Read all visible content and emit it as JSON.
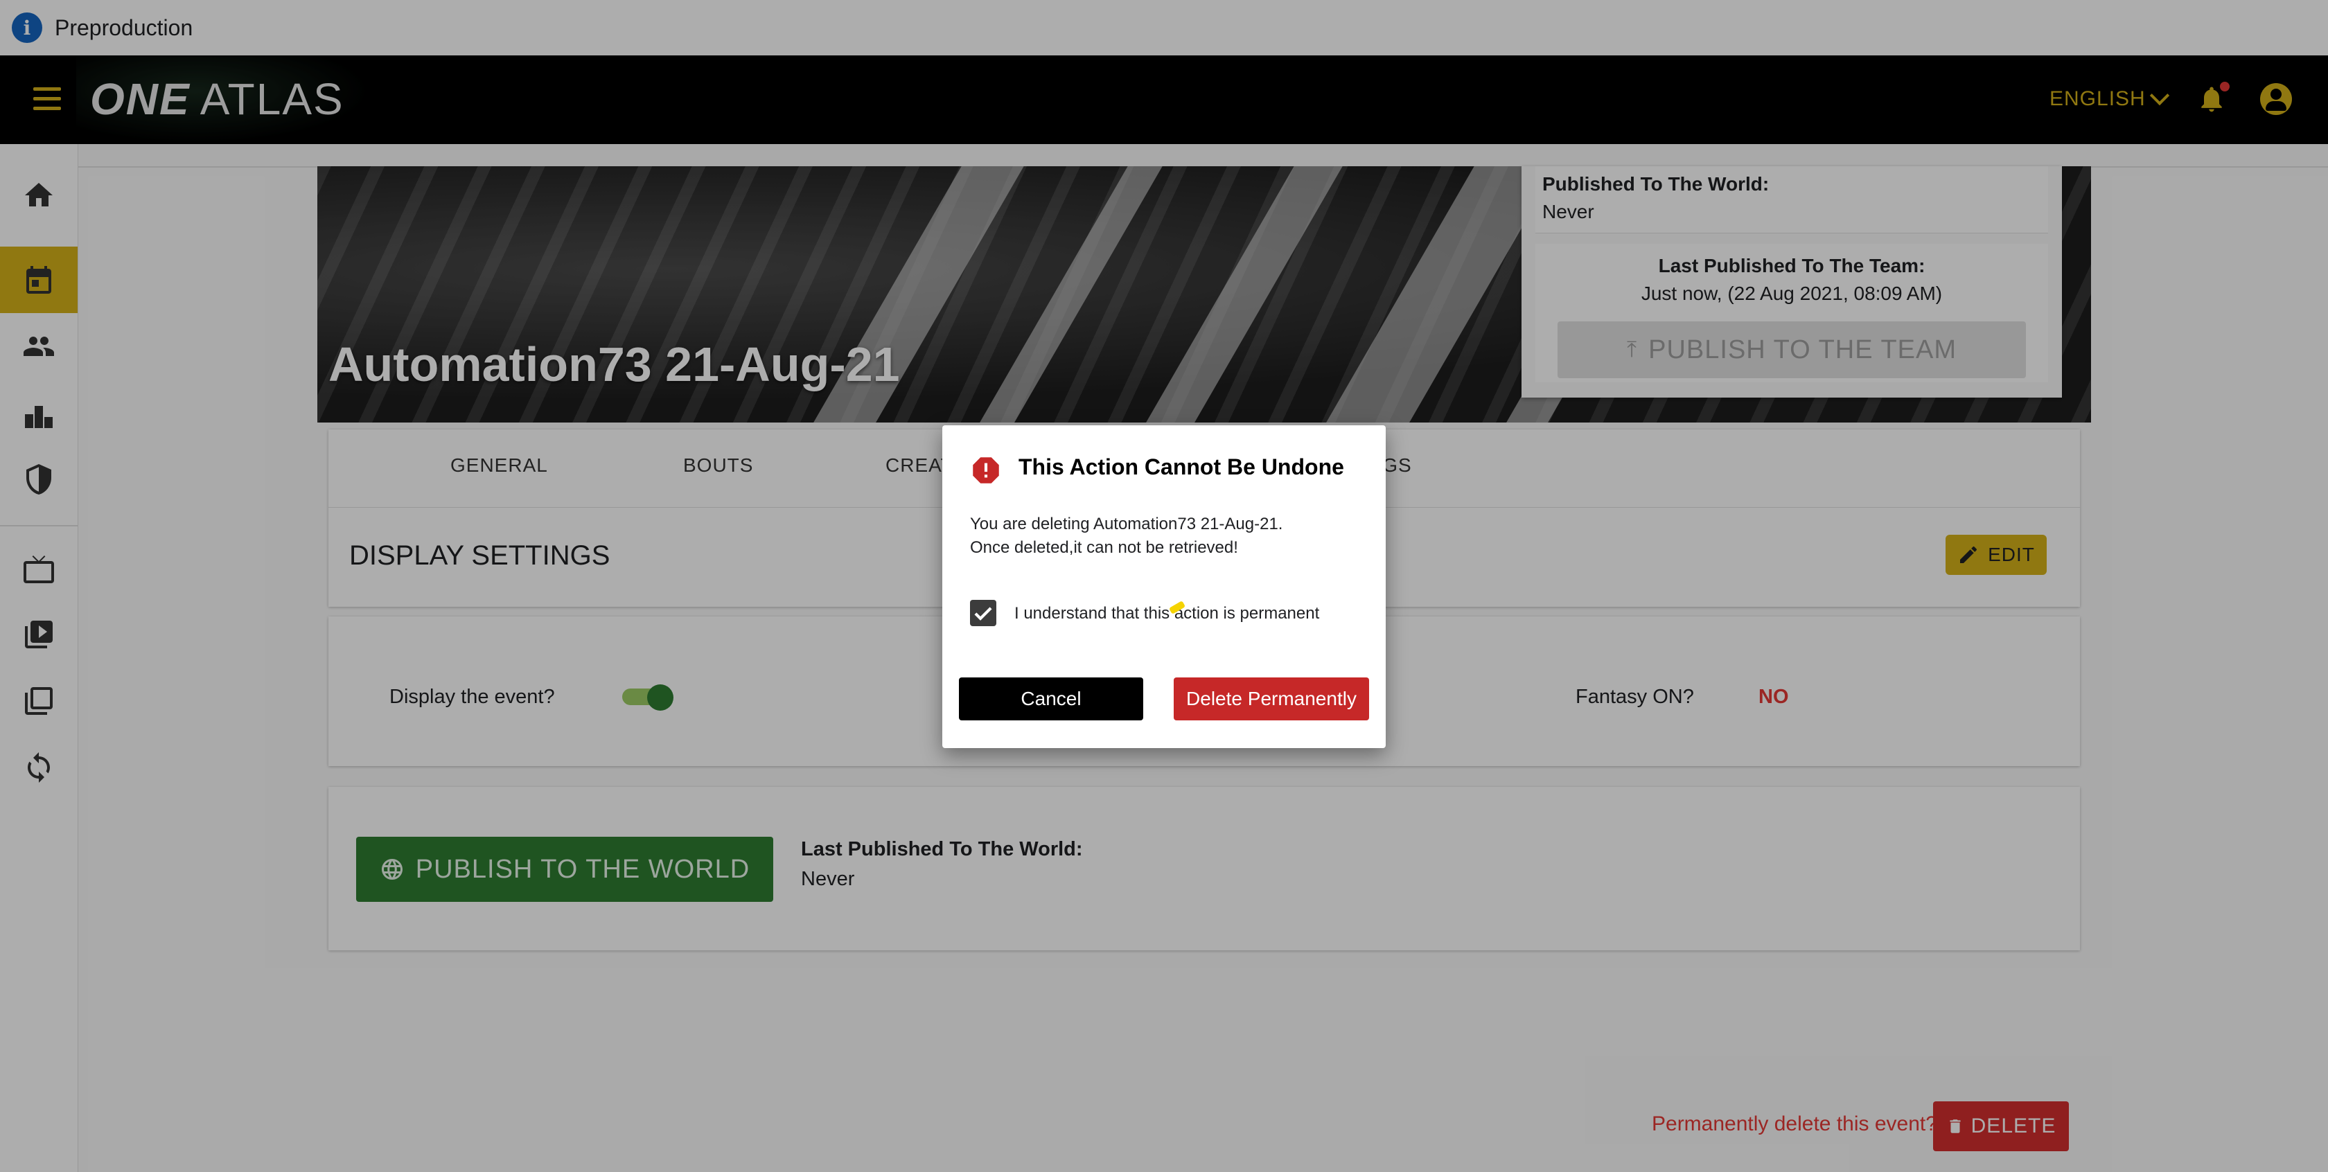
{
  "env": {
    "title": "Preproduction"
  },
  "appbar": {
    "logo_bold": "ONE",
    "logo_light": "ATLAS",
    "language": "ENGLISH"
  },
  "event": {
    "title": "Automation73 21-Aug-21"
  },
  "publish_panel": {
    "world_label": "Published To The World:",
    "world_value": "Never",
    "team_label": "Last Published To The Team:",
    "team_value": "Just now, (22 Aug 2021, 08:09 AM)",
    "team_button": "PUBLISH TO THE TEAM"
  },
  "tabs": {
    "general": "GENERAL",
    "bouts": "BOUTS",
    "creat": "CREAT",
    "ngs": "NGS"
  },
  "display_settings": {
    "title": "DISPLAY SETTINGS",
    "edit": "EDIT",
    "display_label": "Display the event?",
    "fantasy_label": "Fantasy ON?",
    "fantasy_value": "NO"
  },
  "world": {
    "button": "PUBLISH TO THE WORLD",
    "label": "Last Published To The World:",
    "value": "Never"
  },
  "delete": {
    "prompt": "Permanently delete this event?",
    "button": "DELETE"
  },
  "dialog": {
    "title": "This Action Cannot Be Undone",
    "line1": "You are deleting Automation73 21-Aug-21.",
    "line2": "Once deleted,it can not be retrieved!",
    "checkbox_label": "I understand that this action is permanent",
    "checkbox_checked": true,
    "cancel": "Cancel",
    "confirm": "Delete Permanently"
  },
  "colors": {
    "accent": "#d4b21a",
    "danger": "#c62828",
    "publish": "#2e7d32"
  }
}
